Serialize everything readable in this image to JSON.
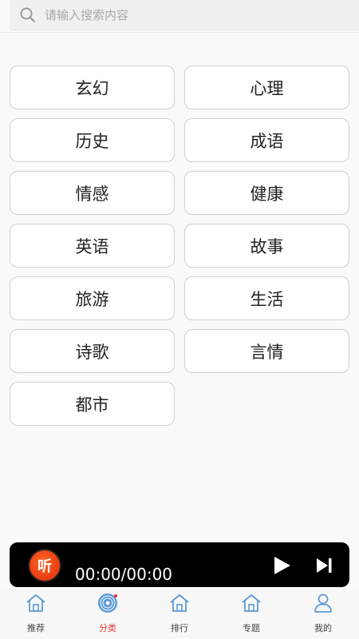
{
  "search": {
    "placeholder": "请输入搜索内容"
  },
  "categories": [
    "玄幻",
    "心理",
    "历史",
    "成语",
    "情感",
    "健康",
    "英语",
    "故事",
    "旅游",
    "生活",
    "诗歌",
    "言情",
    "都市"
  ],
  "player": {
    "logo_text": "听",
    "time": "00:00/00:00"
  },
  "tabs": [
    {
      "label": "推荐",
      "icon": "home-icon",
      "active": false
    },
    {
      "label": "分类",
      "icon": "category-disc-icon",
      "active": true
    },
    {
      "label": "排行",
      "icon": "home-icon",
      "active": false
    },
    {
      "label": "专题",
      "icon": "home-icon",
      "active": false
    },
    {
      "label": "我的",
      "icon": "user-icon",
      "active": false
    }
  ],
  "colors": {
    "accent": "#e33333",
    "tab_icon": "#5b9bd5",
    "player_bg": "#000000"
  }
}
